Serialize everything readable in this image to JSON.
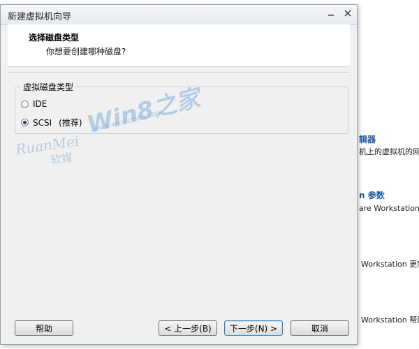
{
  "dialog": {
    "title": "新建虚拟机向导",
    "header_title": "选择磁盘类型",
    "header_subtitle": "你想要创建哪种磁盘?",
    "group_label": "虚拟磁盘类型",
    "options": [
      {
        "label": "IDE",
        "selected": false
      },
      {
        "label": "SCSI",
        "selected": true,
        "note": "(推荐)"
      }
    ],
    "buttons": {
      "help": "帮助",
      "back": "< 上一步(B)",
      "next": "下一步(N) >",
      "cancel": "取消"
    }
  },
  "watermark": {
    "brand1": "RuanMei",
    "brand1_cn": "软媒",
    "brand2": "Win8之家",
    "url": "www.win8china.com"
  },
  "background_text": {
    "line1": "辑器",
    "line2": "机上的虚拟机的网",
    "line3": "n 参数",
    "line4": "are Workstation 设",
    "line5": "Workstation 更新",
    "line6": "Workstation 帮助"
  },
  "colors": {
    "accent_heading": "#1e5aa0",
    "dialog_bg": "#f0f0f0"
  }
}
